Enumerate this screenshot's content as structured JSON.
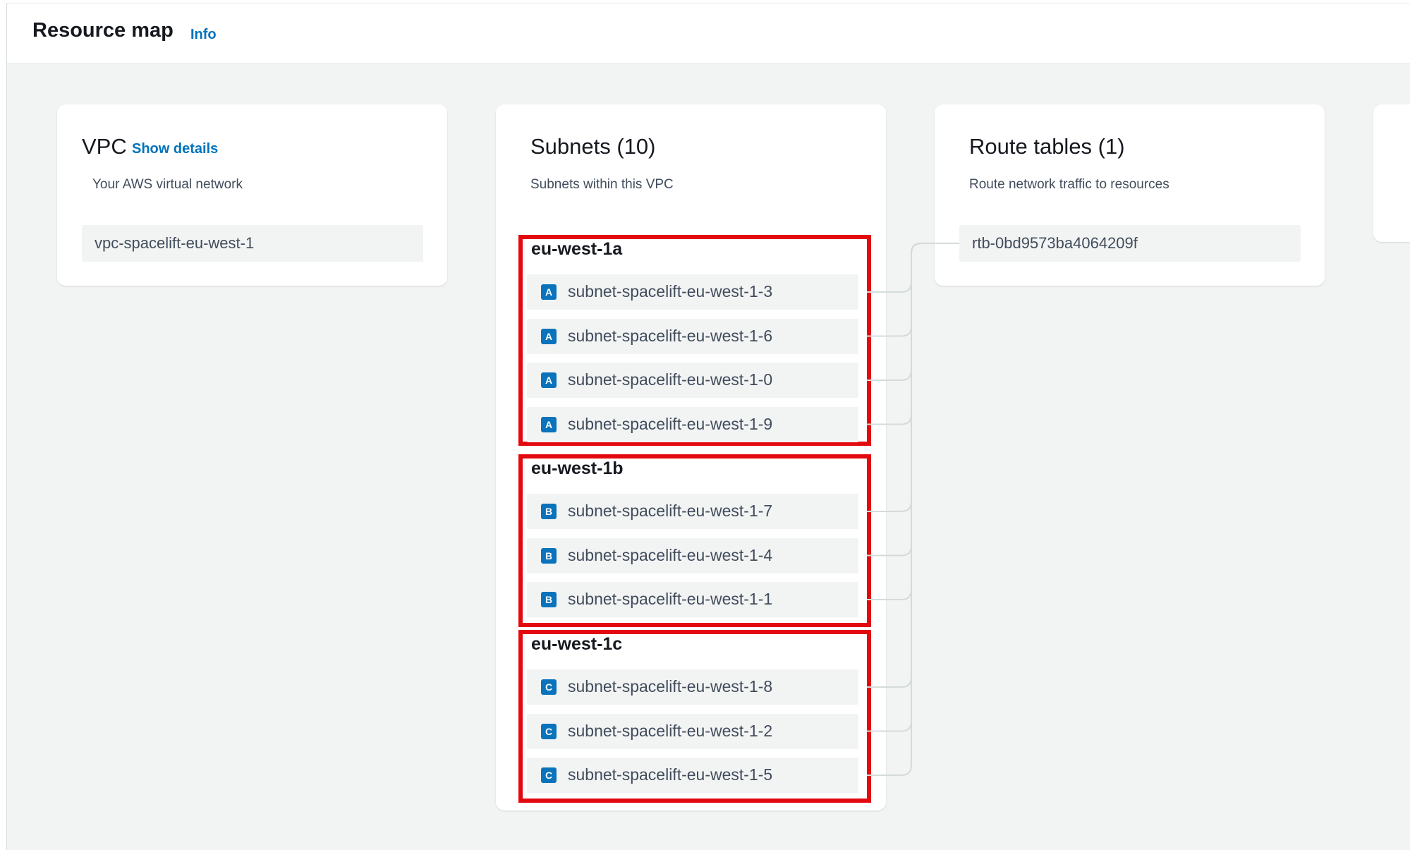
{
  "header": {
    "title": "Resource map",
    "info_label": "Info"
  },
  "vpc": {
    "title": "VPC",
    "show_details_label": "Show details",
    "description": "Your AWS virtual network",
    "name": "vpc-spacelift-eu-west-1"
  },
  "subnets": {
    "title": "Subnets (10)",
    "description": "Subnets within this VPC",
    "zones": [
      {
        "name": "eu-west-1a",
        "badge": "A",
        "items": [
          "subnet-spacelift-eu-west-1-3",
          "subnet-spacelift-eu-west-1-6",
          "subnet-spacelift-eu-west-1-0",
          "subnet-spacelift-eu-west-1-9"
        ]
      },
      {
        "name": "eu-west-1b",
        "badge": "B",
        "items": [
          "subnet-spacelift-eu-west-1-7",
          "subnet-spacelift-eu-west-1-4",
          "subnet-spacelift-eu-west-1-1"
        ]
      },
      {
        "name": "eu-west-1c",
        "badge": "C",
        "items": [
          "subnet-spacelift-eu-west-1-8",
          "subnet-spacelift-eu-west-1-2",
          "subnet-spacelift-eu-west-1-5"
        ]
      }
    ]
  },
  "route_tables": {
    "title": "Route tables (1)",
    "description": "Route network traffic to resources",
    "items": [
      "rtb-0bd9573ba4064209f"
    ]
  },
  "colors": {
    "accent_link": "#0073bb",
    "badge": "#0a73bb",
    "highlight_border": "#e30a0f",
    "connector": "#d5dbdb"
  }
}
